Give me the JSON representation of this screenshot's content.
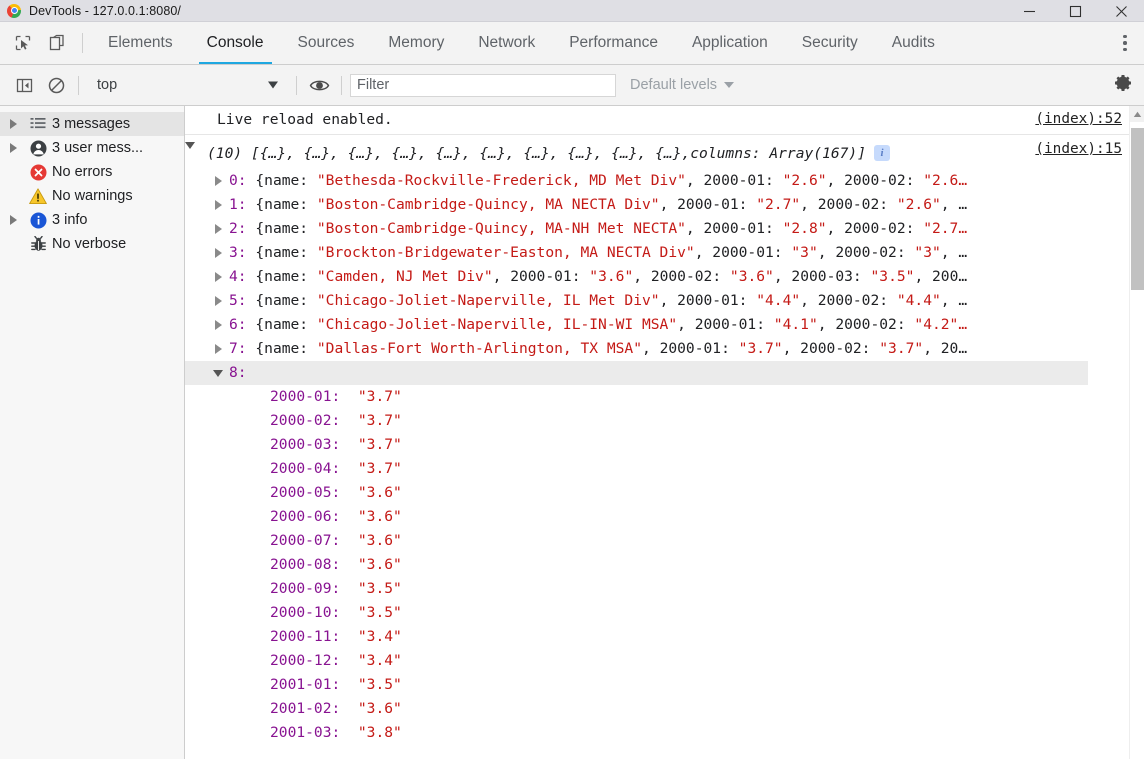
{
  "window": {
    "title": "DevTools - 127.0.0.1:8080/",
    "logo_icon": "chrome-logo",
    "minimize_label": "—",
    "maximize_label": "□",
    "close_label": "✕"
  },
  "tabstrip": {
    "inspect_icon": "inspect-element-icon",
    "device_icon": "toggle-device-toolbar-icon",
    "tabs": [
      {
        "label": "Elements",
        "active": false
      },
      {
        "label": "Console",
        "active": true
      },
      {
        "label": "Sources",
        "active": false
      },
      {
        "label": "Memory",
        "active": false
      },
      {
        "label": "Network",
        "active": false
      },
      {
        "label": "Performance",
        "active": false
      },
      {
        "label": "Application",
        "active": false
      },
      {
        "label": "Security",
        "active": false
      },
      {
        "label": "Audits",
        "active": false
      }
    ],
    "more_icon": "more-options-icon"
  },
  "filterbar": {
    "sidebar_toggle_icon": "show-console-sidebar-icon",
    "clear_icon": "clear-console-icon",
    "context_value": "top",
    "context_caret_icon": "chevron-down-icon",
    "eye_icon": "live-expression-eye-icon",
    "filter_placeholder": "Filter",
    "filter_value": "",
    "levels_label": "Default levels",
    "levels_caret_icon": "chevron-down-icon",
    "settings_icon": "gear-icon"
  },
  "sidebar": {
    "items": [
      {
        "label": "3 messages",
        "icon": "list-icon",
        "expandable": true,
        "selected": true
      },
      {
        "label": "3 user mess...",
        "icon": "person-icon",
        "expandable": true,
        "selected": false
      },
      {
        "label": "No errors",
        "icon": "error-icon",
        "expandable": false,
        "selected": false
      },
      {
        "label": "No warnings",
        "icon": "warning-icon",
        "expandable": false,
        "selected": false
      },
      {
        "label": "3 info",
        "icon": "info-icon",
        "expandable": true,
        "selected": false
      },
      {
        "label": "No verbose",
        "icon": "bug-icon",
        "expandable": false,
        "selected": false
      }
    ]
  },
  "console": {
    "messages": [
      {
        "text": "Live reload enabled.",
        "source": "(index):52"
      }
    ],
    "array_entry": {
      "source": "(index):15",
      "expander_icon": "triangle-down-icon",
      "count_label": "(10)",
      "preview": "[{…}, {…}, {…}, {…}, {…}, {…}, {…}, {…}, {…}, {…}, ",
      "columns_key": "columns:",
      "columns_value": "Array(167)]",
      "info_badge_icon": "info-badge-icon"
    },
    "items": [
      {
        "index": "0:",
        "open_brace": "{name:",
        "name": "\"Bethesda-Rockville-Frederick, MD Met Div\"",
        "pairs": [
          {
            "k": "2000-01:",
            "v": "\"2.6\""
          },
          {
            "k": "2000-02:",
            "v": "\"2.6…"
          }
        ],
        "tail": ""
      },
      {
        "index": "1:",
        "open_brace": "{name:",
        "name": "\"Boston-Cambridge-Quincy, MA NECTA Div\"",
        "pairs": [
          {
            "k": "2000-01:",
            "v": "\"2.7\""
          },
          {
            "k": "2000-02:",
            "v": "\"2.6\""
          }
        ],
        "tail": ", …"
      },
      {
        "index": "2:",
        "open_brace": "{name:",
        "name": "\"Boston-Cambridge-Quincy, MA-NH Met NECTA\"",
        "pairs": [
          {
            "k": "2000-01:",
            "v": "\"2.8\""
          },
          {
            "k": "2000-02:",
            "v": "\"2.7…"
          }
        ],
        "tail": ""
      },
      {
        "index": "3:",
        "open_brace": "{name:",
        "name": "\"Brockton-Bridgewater-Easton, MA NECTA Div\"",
        "pairs": [
          {
            "k": "2000-01:",
            "v": "\"3\""
          },
          {
            "k": "2000-02:",
            "v": "\"3\""
          }
        ],
        "tail": ", …"
      },
      {
        "index": "4:",
        "open_brace": "{name:",
        "name": "\"Camden, NJ Met Div\"",
        "pairs": [
          {
            "k": "2000-01:",
            "v": "\"3.6\""
          },
          {
            "k": "2000-02:",
            "v": "\"3.6\""
          },
          {
            "k": "2000-03:",
            "v": "\"3.5\""
          }
        ],
        "tail": ", 200…"
      },
      {
        "index": "5:",
        "open_brace": "{name:",
        "name": "\"Chicago-Joliet-Naperville, IL Met Div\"",
        "pairs": [
          {
            "k": "2000-01:",
            "v": "\"4.4\""
          },
          {
            "k": "2000-02:",
            "v": "\"4.4\""
          }
        ],
        "tail": ", …"
      },
      {
        "index": "6:",
        "open_brace": "{name:",
        "name": "\"Chicago-Joliet-Naperville, IL-IN-WI MSA\"",
        "pairs": [
          {
            "k": "2000-01:",
            "v": "\"4.1\""
          },
          {
            "k": "2000-02:",
            "v": "\"4.2\"…"
          }
        ],
        "tail": ""
      },
      {
        "index": "7:",
        "open_brace": "{name:",
        "name": "\"Dallas-Fort Worth-Arlington, TX MSA\"",
        "pairs": [
          {
            "k": "2000-01:",
            "v": "\"3.7\""
          },
          {
            "k": "2000-02:",
            "v": "\"3.7\""
          }
        ],
        "tail": ", 20…"
      }
    ],
    "expanded_item": {
      "index": "8:",
      "expander_icon": "triangle-down-icon",
      "properties": [
        {
          "k": "2000-01:",
          "v": "\"3.7\""
        },
        {
          "k": "2000-02:",
          "v": "\"3.7\""
        },
        {
          "k": "2000-03:",
          "v": "\"3.7\""
        },
        {
          "k": "2000-04:",
          "v": "\"3.7\""
        },
        {
          "k": "2000-05:",
          "v": "\"3.6\""
        },
        {
          "k": "2000-06:",
          "v": "\"3.6\""
        },
        {
          "k": "2000-07:",
          "v": "\"3.6\""
        },
        {
          "k": "2000-08:",
          "v": "\"3.6\""
        },
        {
          "k": "2000-09:",
          "v": "\"3.5\""
        },
        {
          "k": "2000-10:",
          "v": "\"3.5\""
        },
        {
          "k": "2000-11:",
          "v": "\"3.4\""
        },
        {
          "k": "2000-12:",
          "v": "\"3.4\""
        },
        {
          "k": "2001-01:",
          "v": "\"3.5\""
        },
        {
          "k": "2001-02:",
          "v": "\"3.6\""
        },
        {
          "k": "2001-03:",
          "v": "\"3.8\""
        }
      ]
    }
  },
  "colors": {
    "string": "#c41a16",
    "key": "#881391",
    "accent": "#1ea7e0",
    "error": "#e53935",
    "warning": "#f5c211",
    "info": "#1a73e8"
  }
}
